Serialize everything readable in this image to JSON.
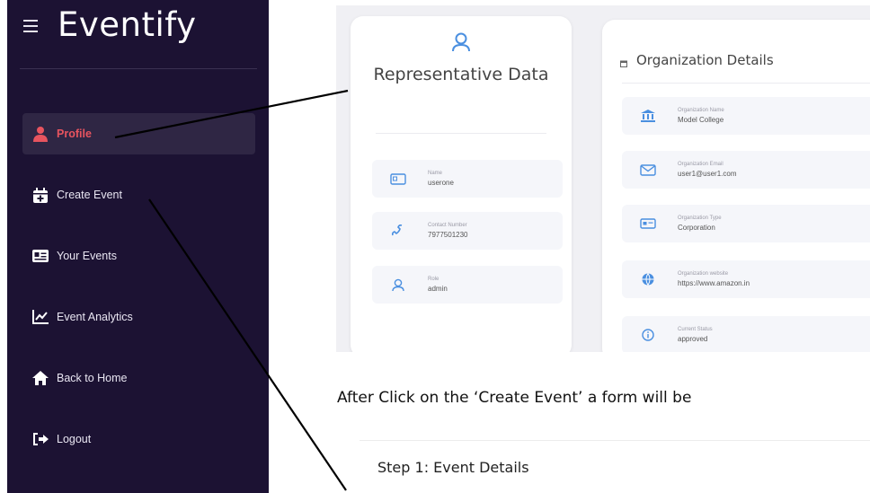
{
  "sidebar": {
    "brand": "Eventify",
    "items": [
      {
        "label": "Profile",
        "icon": "user-icon",
        "active": true
      },
      {
        "label": "Create Event",
        "icon": "calendar-plus-icon"
      },
      {
        "label": "Your Events",
        "icon": "id-card-icon"
      },
      {
        "label": "Event Analytics",
        "icon": "chart-line-icon"
      },
      {
        "label": "Back to Home",
        "icon": "home-icon"
      },
      {
        "label": "Logout",
        "icon": "logout-icon"
      }
    ]
  },
  "profile": {
    "representative": {
      "title": "Representative Data",
      "fields": [
        {
          "label": "Name",
          "value": "userone",
          "icon": "id-card-icon"
        },
        {
          "label": "Contact Number",
          "value": "7977501230",
          "icon": "phone-icon"
        },
        {
          "label": "Role",
          "value": "admin",
          "icon": "user-icon"
        }
      ]
    },
    "organization": {
      "title": "Organization Details",
      "fields": [
        {
          "label": "Organization Name",
          "value": "Model College",
          "icon": "bank-icon"
        },
        {
          "label": "Organization Email",
          "value": "user1@user1.com",
          "icon": "envelope-icon"
        },
        {
          "label": "Organization Type",
          "value": "Corporation",
          "icon": "card-icon"
        },
        {
          "label": "Organization website",
          "value": "https://www.amazon.in",
          "icon": "globe-icon"
        },
        {
          "label": "Current Status",
          "value": "approved",
          "icon": "info-icon"
        }
      ]
    }
  },
  "caption": "After Click on the ‘Create Event’ a form will be",
  "form": {
    "step_title": "Step 1: Event Details"
  },
  "colors": {
    "sidebar_bg": "#1c1233",
    "accent": "#e8545f",
    "icon_blue": "#4a8fe0"
  }
}
